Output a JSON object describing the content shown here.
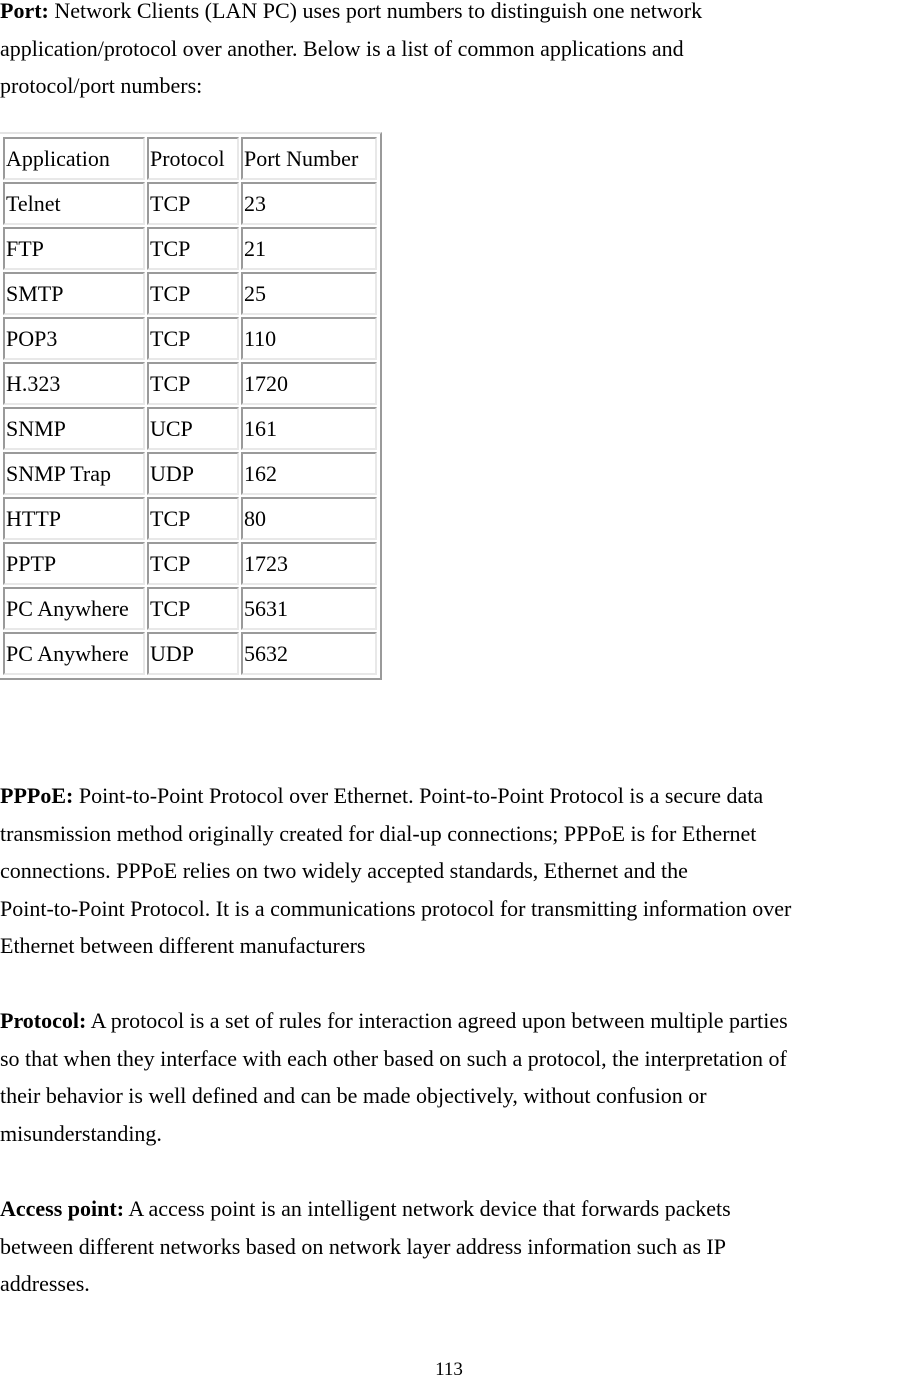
{
  "port": {
    "term": "Port:",
    "lines": [
      " Network Clients (LAN PC) uses port numbers to distinguish one network",
      "application/protocol over another. Below is a list of common applications and",
      "protocol/port numbers:"
    ]
  },
  "port_table": {
    "headers": [
      "Application",
      "Protocol",
      "Port Number"
    ],
    "rows": [
      [
        "Telnet",
        "TCP",
        "23"
      ],
      [
        "FTP",
        "TCP",
        "21"
      ],
      [
        "SMTP",
        "TCP",
        "25"
      ],
      [
        "POP3",
        "TCP",
        "110"
      ],
      [
        "H.323",
        "TCP",
        "1720"
      ],
      [
        "SNMP",
        "UCP",
        "161"
      ],
      [
        "SNMP Trap",
        "UDP",
        "162"
      ],
      [
        "HTTP",
        "TCP",
        "80"
      ],
      [
        "PPTP",
        "TCP",
        "1723"
      ],
      [
        "PC Anywhere",
        "TCP",
        "5631"
      ],
      [
        "PC Anywhere",
        "UDP",
        "5632"
      ]
    ]
  },
  "pppoe": {
    "term": "PPPoE:",
    "lines": [
      " Point-to-Point Protocol over Ethernet. Point-to-Point Protocol is a secure data",
      "transmission method originally created for dial-up connections; PPPoE is for Ethernet",
      "connections. PPPoE relies on two widely accepted standards, Ethernet and the",
      "Point-to-Point Protocol. It is a communications protocol for transmitting information over",
      "Ethernet between different manufacturers"
    ]
  },
  "protocol": {
    "term": "Protocol:",
    "lines": [
      " A protocol is a set of rules for interaction agreed upon between multiple parties",
      "so that when they interface with each other based on such a protocol, the interpretation of",
      "their behavior is well defined and can be made objectively, without confusion or",
      "misunderstanding."
    ]
  },
  "access_point": {
    "term": "Access point:",
    "lines": [
      " A access point is an intelligent network device that forwards packets",
      "between different networks based on network layer address information such as IP",
      "addresses."
    ]
  },
  "page_number": "113"
}
